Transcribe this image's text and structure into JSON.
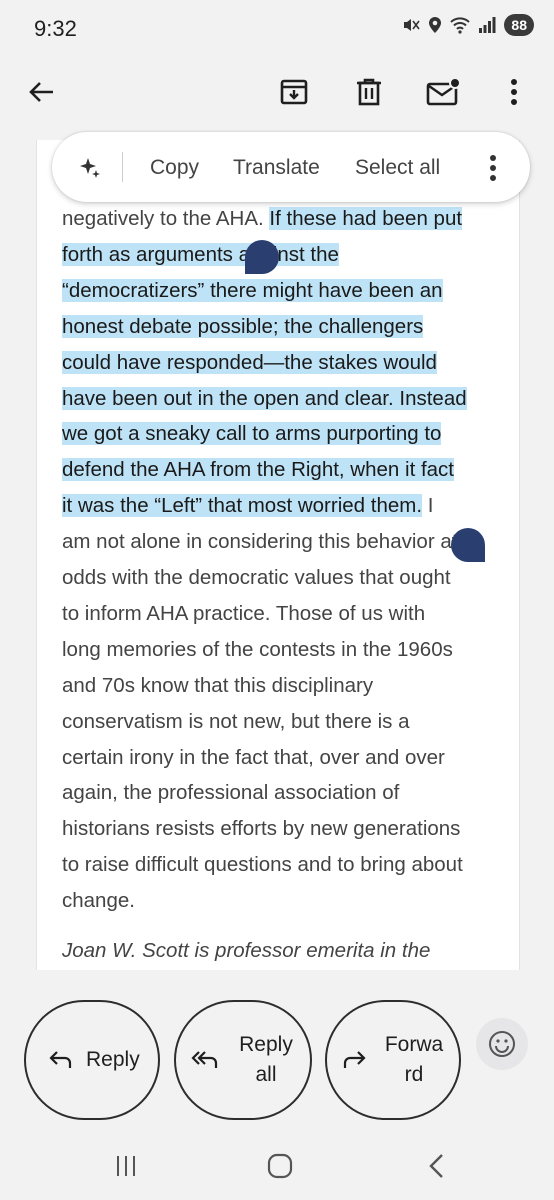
{
  "status": {
    "time": "9:32",
    "battery": "88"
  },
  "toolbar": {
    "back": "back-arrow-icon",
    "archive": "archive-icon",
    "delete": "trash-icon",
    "mark_unread": "mail-unread-icon",
    "more": "more-vert-icon"
  },
  "selection_menu": {
    "copy": "Copy",
    "translate": "Translate",
    "select_all": "Select all"
  },
  "body": {
    "lines": [
      {
        "pre": "negatively to the AHA. ",
        "hl": "If these had been put",
        "post": ""
      },
      {
        "pre": "",
        "hl": "forth as arguments against the",
        "post": ""
      },
      {
        "pre": "",
        "hl": "“democratizers” there might have been an",
        "post": ""
      },
      {
        "pre": "",
        "hl": "honest debate possible; the challengers",
        "post": ""
      },
      {
        "pre": "",
        "hl": "could have responded—the stakes would",
        "post": ""
      },
      {
        "pre": "",
        "hl": "have been out in the open and clear. Instead",
        "post": ""
      },
      {
        "pre": "",
        "hl": "we got a sneaky call to arms purporting to",
        "post": ""
      },
      {
        "pre": "",
        "hl": "defend the AHA from the Right, when it fact",
        "post": ""
      },
      {
        "pre": "",
        "hl": "it was the “Left” that most worried them.",
        "post": " I"
      },
      {
        "pre": "am not alone in considering this behavior at",
        "hl": "",
        "post": ""
      },
      {
        "pre": "odds with the democratic values that ought",
        "hl": "",
        "post": ""
      },
      {
        "pre": "to inform AHA practice. Those of us with",
        "hl": "",
        "post": ""
      },
      {
        "pre": "long memories of the contests in the 1960s",
        "hl": "",
        "post": ""
      },
      {
        "pre": "and 70s know that this disciplinary",
        "hl": "",
        "post": ""
      },
      {
        "pre": "conservatism is not new, but there is a",
        "hl": "",
        "post": ""
      },
      {
        "pre": "certain irony in the fact that, over and over",
        "hl": "",
        "post": ""
      },
      {
        "pre": "again, the professional association of",
        "hl": "",
        "post": ""
      },
      {
        "pre": "historians resists efforts by new generations",
        "hl": "",
        "post": ""
      },
      {
        "pre": "to raise difficult questions and to bring about",
        "hl": "",
        "post": ""
      },
      {
        "pre": "change.",
        "hl": "",
        "post": ""
      }
    ],
    "signature": "Joan W. Scott is professor emerita in the"
  },
  "actions": {
    "reply": "Reply",
    "reply_all_1": "Reply",
    "reply_all_2": "all",
    "forward_1": "Forwa",
    "forward_2": "rd"
  },
  "colors": {
    "highlight": "#bfe3f6",
    "handle": "#2a3f70",
    "background": "#f2f2f3"
  }
}
